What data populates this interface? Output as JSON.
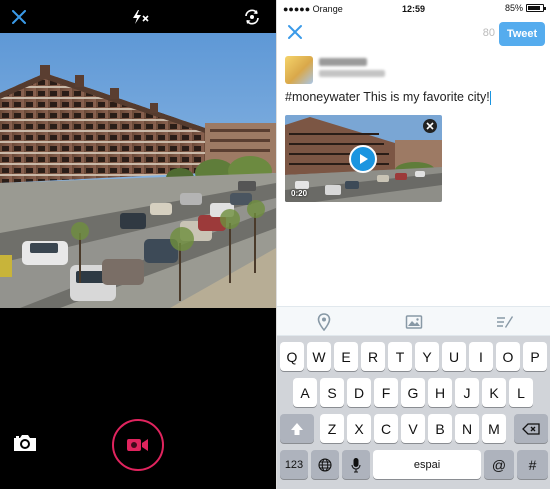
{
  "camera": {
    "close_icon": "close-icon",
    "flash_icon": "flash-off-icon",
    "flip_icon": "camera-flip-icon",
    "snapshot_icon": "camera-icon",
    "record_icon": "video-camera-icon",
    "accent_color": "#e0245e"
  },
  "status_bar": {
    "carrier": "●●●●● Orange",
    "time": "12:59",
    "battery_percent": "85%",
    "battery_level": 0.85
  },
  "compose": {
    "char_count": "80",
    "tweet_label": "Tweet",
    "tweet_text": "#moneywater This is my favorite city!",
    "accent_color": "#55acee"
  },
  "media": {
    "duration": "0:20"
  },
  "toolbar": {
    "icons": [
      "location-icon",
      "image-icon",
      "drafts-icon"
    ]
  },
  "keyboard": {
    "row1": [
      "Q",
      "W",
      "E",
      "R",
      "T",
      "Y",
      "U",
      "I",
      "O",
      "P"
    ],
    "row2": [
      "A",
      "S",
      "D",
      "F",
      "G",
      "H",
      "J",
      "K",
      "L"
    ],
    "row3": [
      "Z",
      "X",
      "C",
      "V",
      "B",
      "N",
      "M"
    ],
    "numbers_label": "123",
    "space_label": "espai",
    "at_label": "@",
    "hash_label": "#"
  }
}
